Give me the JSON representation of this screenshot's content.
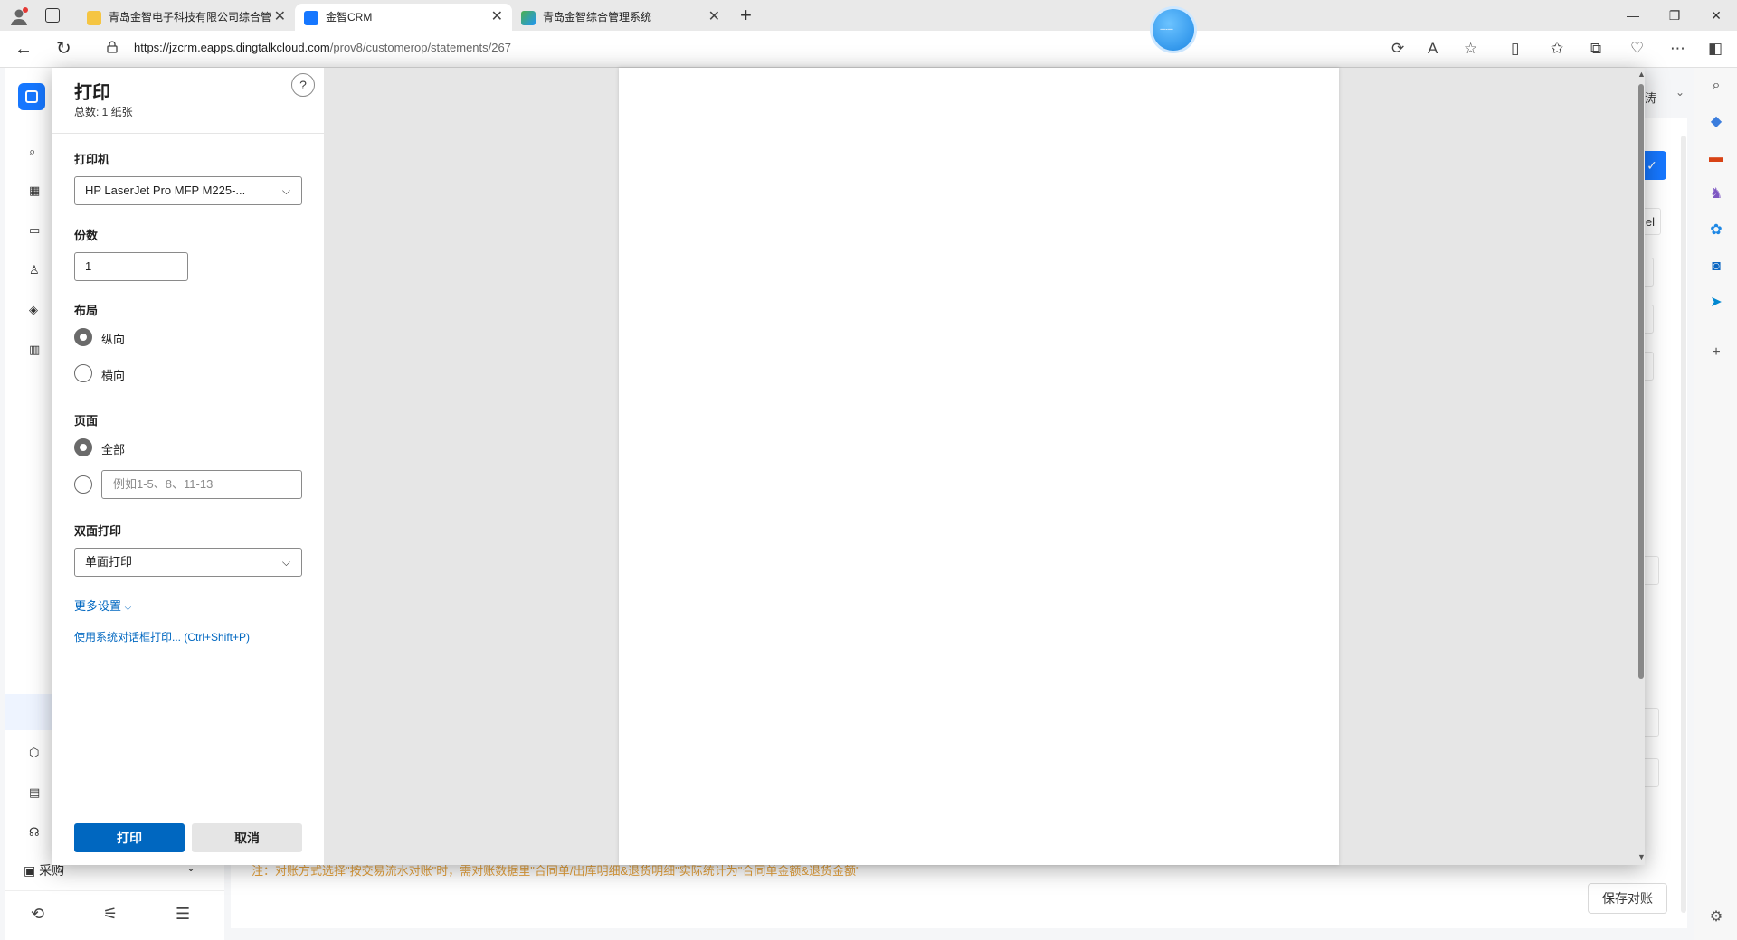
{
  "browser": {
    "tabs": [
      {
        "title": "青岛金智电子科技有限公司综合管",
        "active": false
      },
      {
        "title": "金智CRM",
        "active": true
      },
      {
        "title": "青岛金智综合管理系统",
        "active": false
      }
    ],
    "url_host": "https://jzcrm.eapps.dingtalkcloud.com",
    "url_path": "/prov8/customerop/statements/267"
  },
  "app": {
    "user_name_partial": "涛",
    "side_menu_caigou": "采购",
    "blue_button_glyph": "✓",
    "note": "注：对账方式选择\"按交易流水对账\"时，需对账数据里\"合同单/出库明细&退货明细\"实际统计为\"合同单金额&退货金额\"",
    "save_button": "保存对账",
    "ghost_text": "el"
  },
  "print_dialog": {
    "title": "打印",
    "subtitle": "总数: 1 纸张",
    "help": "?",
    "printer_label": "打印机",
    "printer_value": "HP LaserJet Pro MFP M225-...",
    "copies_label": "份数",
    "copies_value": "1",
    "layout_label": "布局",
    "layout_options": [
      {
        "label": "纵向",
        "selected": true
      },
      {
        "label": "横向",
        "selected": false
      }
    ],
    "pages_label": "页面",
    "pages_all": "全部",
    "pages_range_placeholder": "例如1-5、8、11-13",
    "duplex_label": "双面打印",
    "duplex_value": "单面打印",
    "more_settings": "更多设置",
    "system_dialog_link": "使用系统对话框打印... (Ctrl+Shift+P)",
    "print_button": "打印",
    "cancel_button": "取消"
  }
}
